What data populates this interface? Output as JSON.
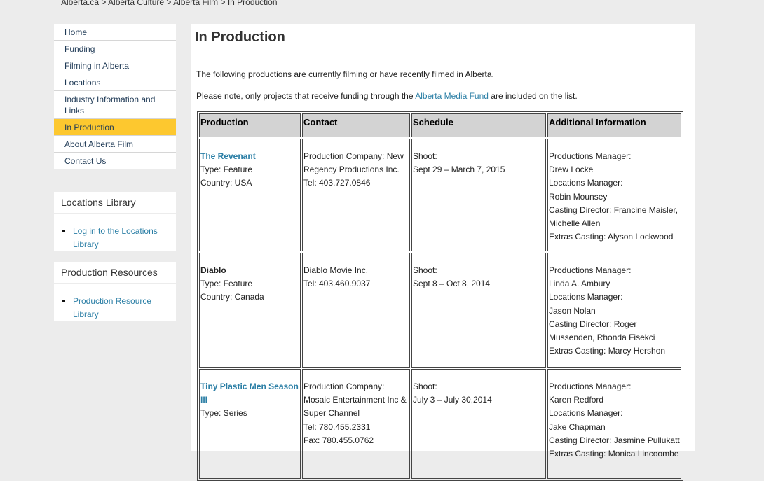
{
  "breadcrumb": [
    "Alberta.ca",
    "Alberta Culture",
    "Alberta Film",
    "In Production"
  ],
  "nav": {
    "items": [
      {
        "label": "Home",
        "active": false
      },
      {
        "label": "Funding",
        "active": false
      },
      {
        "label": "Filming in Alberta",
        "active": false
      },
      {
        "label": "Locations",
        "active": false
      },
      {
        "label": "Industry Information and Links",
        "active": false
      },
      {
        "label": "In Production",
        "active": true
      },
      {
        "label": "About Alberta Film",
        "active": false
      },
      {
        "label": "Contact Us",
        "active": false
      }
    ]
  },
  "locations_library": {
    "title": "Locations Library",
    "links": [
      "Log in to the Locations Library"
    ]
  },
  "production_resources": {
    "title": "Production Resources",
    "links": [
      "Production Resource Library"
    ]
  },
  "main": {
    "title": "In Production",
    "intro1": "The following productions are currently filming or have recently filmed in Alberta.",
    "intro2_before": "Please note, only projects that receive funding through the ",
    "intro2_link": "Alberta Media Fund",
    "intro2_after": " are included on the list.",
    "table": {
      "headers": [
        "Production",
        "Contact",
        "Schedule",
        "Additional Information"
      ],
      "rows": [
        {
          "name": "The Revenant",
          "name_is_link": true,
          "production": [
            "Type: Feature",
            "Country: USA"
          ],
          "contact": [
            "Production Company: New Regency Productions Inc.",
            "Tel: 403.727.0846"
          ],
          "schedule": [
            "Shoot:",
            "Sept 29 – March 7, 2015"
          ],
          "info": [
            "Productions Manager:",
            "Drew Locke",
            "Locations Manager:",
            "Robin Mounsey",
            "Casting Director: Francine Maisler, Michelle Allen",
            "Extras Casting: Alyson Lockwood"
          ]
        },
        {
          "name": "Diablo",
          "name_is_link": false,
          "production": [
            "Type: Feature",
            "Country: Canada"
          ],
          "contact": [
            "Diablo Movie Inc.",
            "Tel: 403.460.9037"
          ],
          "schedule": [
            "Shoot:",
            "Sept 8 – Oct 8, 2014"
          ],
          "info": [
            "Productions Manager:",
            "Linda A. Ambury",
            "Locations Manager:",
            "Jason Nolan",
            "Casting Director: Roger Mussenden, Rhonda Fisekci",
            "Extras Casting: Marcy Hershon"
          ]
        },
        {
          "name": "Tiny Plastic Men Season III",
          "name_is_link": true,
          "production": [
            "Type: Series"
          ],
          "contact": [
            "Production Company: Mosaic Entertainment Inc & Super Channel",
            "Tel: 780.455.2331",
            "Fax: 780.455.0762"
          ],
          "schedule": [
            "Shoot:",
            "July 3 – July 30,2014"
          ],
          "info": [
            "Productions Manager:",
            "Karen Redford",
            "Locations Manager:",
            "Jake Chapman",
            "Casting Director: Jasmine Pullukatt",
            "Extras Casting: Monica Lincoombe"
          ]
        }
      ]
    }
  },
  "colors": {
    "page_bg": "#ececec",
    "active_nav": "#fdc82f",
    "link": "#2a7ea5",
    "header_cell": "#d3d3d3"
  }
}
